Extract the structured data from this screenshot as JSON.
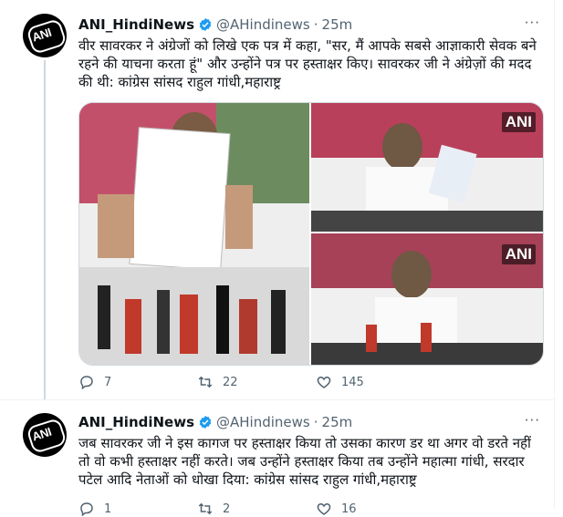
{
  "tweets": [
    {
      "author_name": "ANI_HindiNews",
      "handle": "@AHindinews",
      "separator": "·",
      "time": "25m",
      "avatar_text": "ANI",
      "text": "वीर सावरकर ने अंग्रेजों को लिखे एक पत्र में कहा, \"सर, मैं आपके सबसे आज्ञाकारी सेवक बने रहने की याचना करता हूं\" और उन्होंने पत्र पर हस्ताक्षर किए। सावरकर जी ने अंग्रेज़ों की मदद की थी: कांग्रेस सांसद राहुल गांधी,महाराष्ट्र",
      "media_watermark": "ANI",
      "replies": "7",
      "retweets": "22",
      "likes": "145",
      "more": "···"
    },
    {
      "author_name": "ANI_HindiNews",
      "handle": "@AHindinews",
      "separator": "·",
      "time": "25m",
      "avatar_text": "ANI",
      "text": "जब सावरकर जी ने इस कागज पर हस्ताक्षर किया तो उसका कारण डर था अगर वो डरते नहीं तो वो कभी हस्ताक्षर नहीं करते। जब उन्होंने हस्ताक्षर किया तब उन्होंने महात्मा गांधी, सरदार पटेल आदि नेताओं को धोखा दिया: कांग्रेस सांसद राहुल गांधी,महाराष्ट्र",
      "replies": "1",
      "retweets": "2",
      "likes": "16",
      "more": "···"
    }
  ],
  "colors": {
    "verified": "#1d9bf0",
    "secondary_text": "#536471",
    "border": "#cfd9de"
  },
  "icons": [
    "verified-badge-icon",
    "reply-icon",
    "retweet-icon",
    "like-icon",
    "more-icon"
  ]
}
